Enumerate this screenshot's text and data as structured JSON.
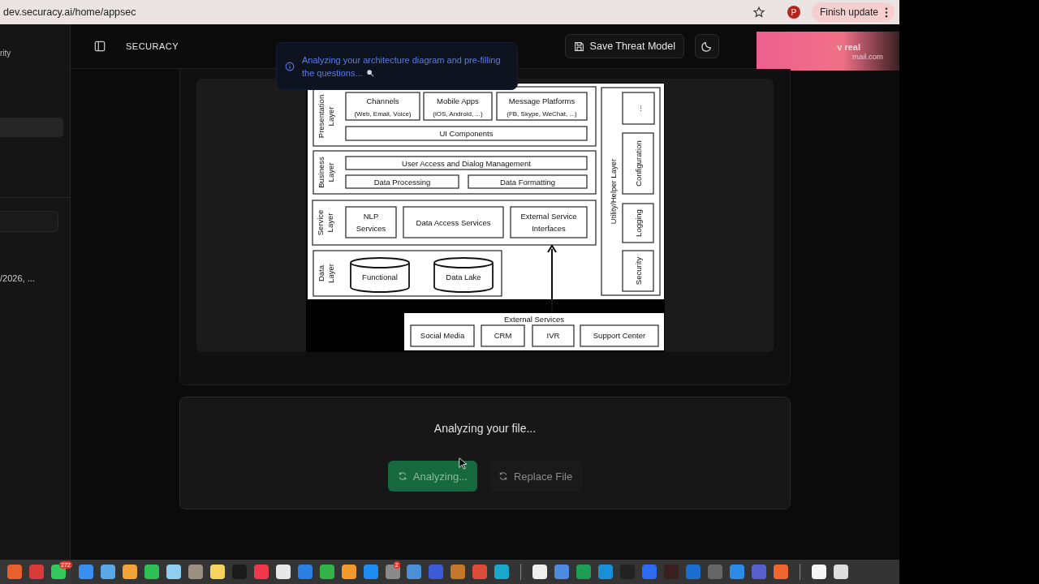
{
  "browser": {
    "url": "dev.securacy.ai/home/appsec",
    "profile": "P",
    "update_button": "Finish update"
  },
  "sidebar": {
    "title_fragment": "rity",
    "items": [
      {
        "selected": true
      }
    ],
    "entry_date": "/2026, ..."
  },
  "header": {
    "logo": "SECURACY",
    "save_button": "Save Threat Model",
    "user": {
      "name": "v real",
      "email": "mail.com"
    }
  },
  "toast": {
    "message": "Analyzing your architecture diagram and pre-filling the questions..."
  },
  "diagram": {
    "layers": [
      {
        "label": [
          "Presentation",
          "Layer"
        ],
        "boxes": [
          {
            "kind": "box",
            "lines": [
              "Channels"
            ],
            "subtitle": "(Web, Email, Voice)"
          },
          {
            "kind": "box",
            "lines": [
              "Mobile Apps"
            ],
            "subtitle": "(iOS, Android, ...)"
          },
          {
            "kind": "box",
            "lines": [
              "Message Platforms"
            ],
            "subtitle": "(FB, Skype, WeChat, ...)"
          },
          {
            "kind": "box",
            "lines": [
              "UI Components"
            ]
          }
        ]
      },
      {
        "label": [
          "Business",
          "Layer"
        ],
        "boxes": [
          {
            "kind": "box",
            "lines": [
              "User Access and Dialog Management"
            ]
          },
          {
            "kind": "box",
            "lines": [
              "Data Processing"
            ]
          },
          {
            "kind": "box",
            "lines": [
              "Data Formatting"
            ]
          }
        ]
      },
      {
        "label": [
          "Service",
          "Layer"
        ],
        "boxes": [
          {
            "kind": "box",
            "lines": [
              "NLP",
              "Services"
            ]
          },
          {
            "kind": "box",
            "lines": [
              "Data Access Services"
            ]
          },
          {
            "kind": "box",
            "lines": [
              "External Service",
              "Interfaces"
            ]
          }
        ]
      },
      {
        "label": [
          "Data",
          "Layer"
        ],
        "boxes": [
          {
            "kind": "cylinder",
            "lines": [
              "Functional"
            ]
          },
          {
            "kind": "cylinder",
            "lines": [
              "Data Lake"
            ]
          }
        ]
      }
    ],
    "utility": {
      "label": "Utility/Helper Layer",
      "items": [
        "...",
        "Configuration",
        "Logging",
        "Security"
      ]
    },
    "external": {
      "title": "External Services",
      "items": [
        "Social Media",
        "CRM",
        "IVR",
        "Support Center"
      ]
    }
  },
  "upload": {
    "status": "Analyzing your file...",
    "buttons": [
      {
        "kind": "primary",
        "label": "Analyzing...",
        "disabled": true
      },
      {
        "kind": "secondary",
        "label": "Replace File",
        "disabled": true
      }
    ]
  },
  "dock": {
    "apps": [
      {
        "color": "#e8602c"
      },
      {
        "color": "#d93b3b"
      },
      {
        "color": "#34c759",
        "badge": "272"
      },
      {
        "color": "#3a8ef0"
      },
      {
        "color": "#5aa9e6"
      },
      {
        "color": "#f2a33a"
      },
      {
        "color": "#2fbf55"
      },
      {
        "color": "#8fd0f0"
      },
      {
        "color": "#9a8f80"
      },
      {
        "color": "#f4d35e"
      },
      {
        "color": "#1b1b1b"
      },
      {
        "color": "#f0384b"
      },
      {
        "color": "#e8e8e8"
      },
      {
        "color": "#2a7fe0"
      },
      {
        "color": "#33b24a"
      },
      {
        "color": "#f29a2e"
      },
      {
        "color": "#1e8cf0"
      },
      {
        "color": "#8a8a8a",
        "badge": "2"
      },
      {
        "color": "#4a90d9"
      },
      {
        "color": "#3c5bd6"
      },
      {
        "color": "#c4782e"
      },
      {
        "color": "#dd4b39"
      },
      {
        "color": "#1aa7c9"
      },
      {
        "color": "#eeeeee"
      },
      {
        "color": "#4c8be0"
      },
      {
        "color": "#1f9d55"
      },
      {
        "color": "#1a8fd6"
      },
      {
        "color": "#222222"
      },
      {
        "color": "#2d6cf0"
      },
      {
        "color": "#3a1f1f"
      },
      {
        "color": "#1b6fd1"
      },
      {
        "color": "#666666"
      },
      {
        "color": "#2b8be6"
      },
      {
        "color": "#5a5fd0"
      },
      {
        "color": "#f0662f"
      },
      {
        "color": "#f4f4f4"
      },
      {
        "color": "#dddddd"
      }
    ]
  }
}
